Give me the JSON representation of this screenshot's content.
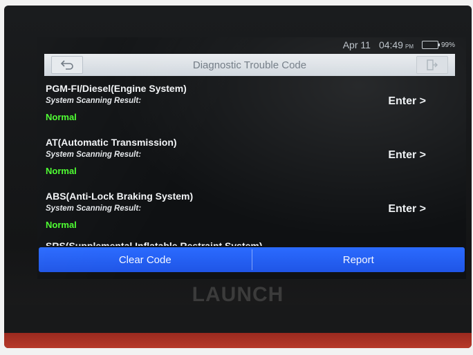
{
  "status_bar": {
    "date": "Apr 11",
    "time": "04:49",
    "ampm": "PM",
    "battery": "99%"
  },
  "header": {
    "title": "Diagnostic Trouble Code",
    "back_icon": "return-arrow-icon",
    "exit_icon": "exit-door-icon"
  },
  "systems": [
    {
      "name": "PGM-FI/Diesel(Engine System)",
      "subtitle": "System Scanning Result:",
      "status": "Normal",
      "enter_label": "Enter >"
    },
    {
      "name": "AT(Automatic Transmission)",
      "subtitle": "System Scanning Result:",
      "status": "Normal",
      "enter_label": "Enter >"
    },
    {
      "name": "ABS(Anti-Lock Braking System)",
      "subtitle": "System Scanning Result:",
      "status": "Normal",
      "enter_label": "Enter >"
    },
    {
      "name": "SRS(Supplemental Inflatable Restraint System)"
    }
  ],
  "actions": {
    "clear_code": "Clear Code",
    "report": "Report"
  },
  "device": {
    "brand": "LAUNCH"
  },
  "colors": {
    "accent_blue": "#2b6bff",
    "status_green": "#4cff2f"
  }
}
